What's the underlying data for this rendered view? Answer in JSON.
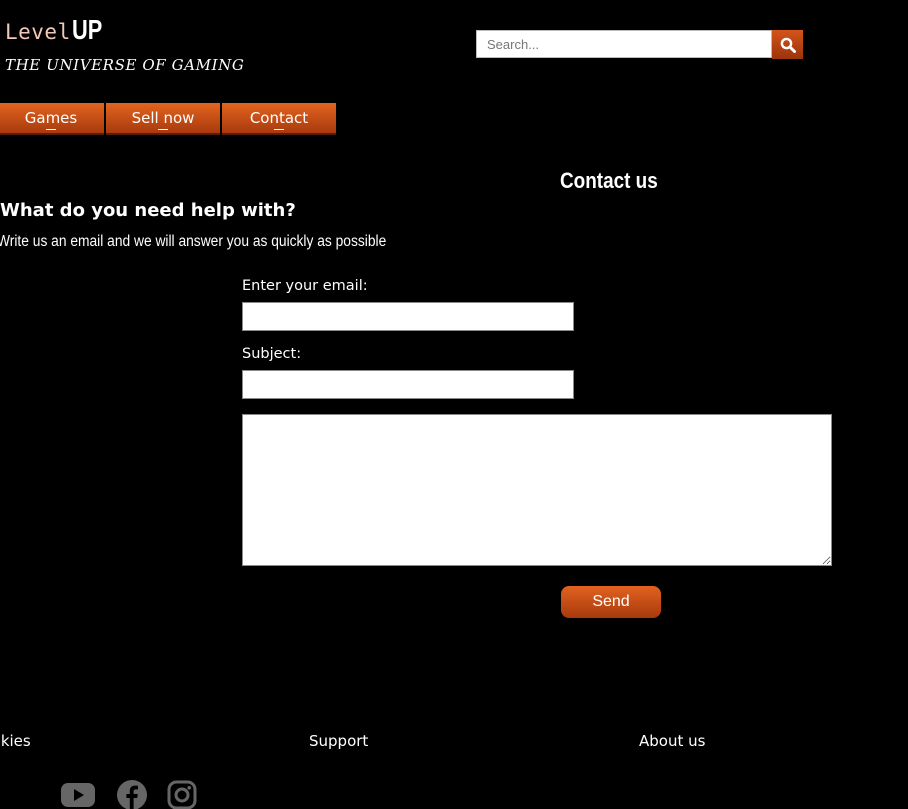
{
  "logo": {
    "level": "Level",
    "up": "UP",
    "tagline": "THE UNIVERSE OF GAMING"
  },
  "search": {
    "placeholder": "Search...",
    "icon": "search-icon"
  },
  "nav": {
    "items": [
      {
        "label": "Games"
      },
      {
        "label": "Sell now"
      },
      {
        "label": "Contact"
      }
    ]
  },
  "main": {
    "title": "Contact us",
    "help_heading": "What do you need help with?",
    "help_sub": "Write us an email and we will answer you as quickly as possible",
    "email_label": "Enter your email:",
    "email_value": "",
    "subject_label": "Subject:",
    "subject_value": "",
    "message_value": "",
    "send_label": "Send"
  },
  "footer": {
    "links": [
      {
        "label": "Cookies"
      },
      {
        "label": "Support"
      },
      {
        "label": "About us"
      }
    ],
    "social": [
      {
        "icon": "youtube-icon"
      },
      {
        "icon": "facebook-icon"
      },
      {
        "icon": "instagram-icon"
      }
    ]
  },
  "colors": {
    "background": "#000000",
    "accent": "#c8481a",
    "accent_dark": "#a83a0d",
    "logo_level": "#f2c9b7",
    "social_icon": "#666666"
  }
}
